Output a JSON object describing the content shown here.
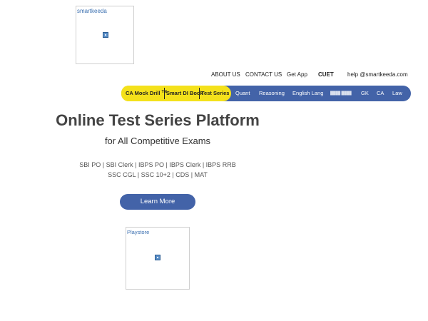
{
  "logo": {
    "alt_text": "smartkeeda"
  },
  "top_nav": {
    "about": "ABOUT US",
    "contact": "CONTACT US",
    "get_app": "Get App",
    "cuet": "CUET",
    "email": "help @smartkeeda.com"
  },
  "main_nav": {
    "highlighted": {
      "mock_drill": "CA Mock Drill",
      "tm": "TM",
      "di_book": "Smart DI Book",
      "test_series": "Test Series"
    },
    "items": [
      "Quant",
      "Reasoning",
      "English Lang",
      "████ ████",
      "GK",
      "CA",
      "Law"
    ],
    "colors": {
      "bar": "#4363a8",
      "highlight": "#f4e11b"
    }
  },
  "hero": {
    "title": "Online Test Series Platform",
    "subtitle": "for All Competitive Exams",
    "exams_line1": "SBI PO | SBI Clerk | IBPS PO | IBPS Clerk | IBPS RRB",
    "exams_line2": "SSC CGL | SSC 10+2 | CDS | MAT",
    "cta": "Learn More"
  },
  "playstore": {
    "alt_text": "Playstore"
  }
}
